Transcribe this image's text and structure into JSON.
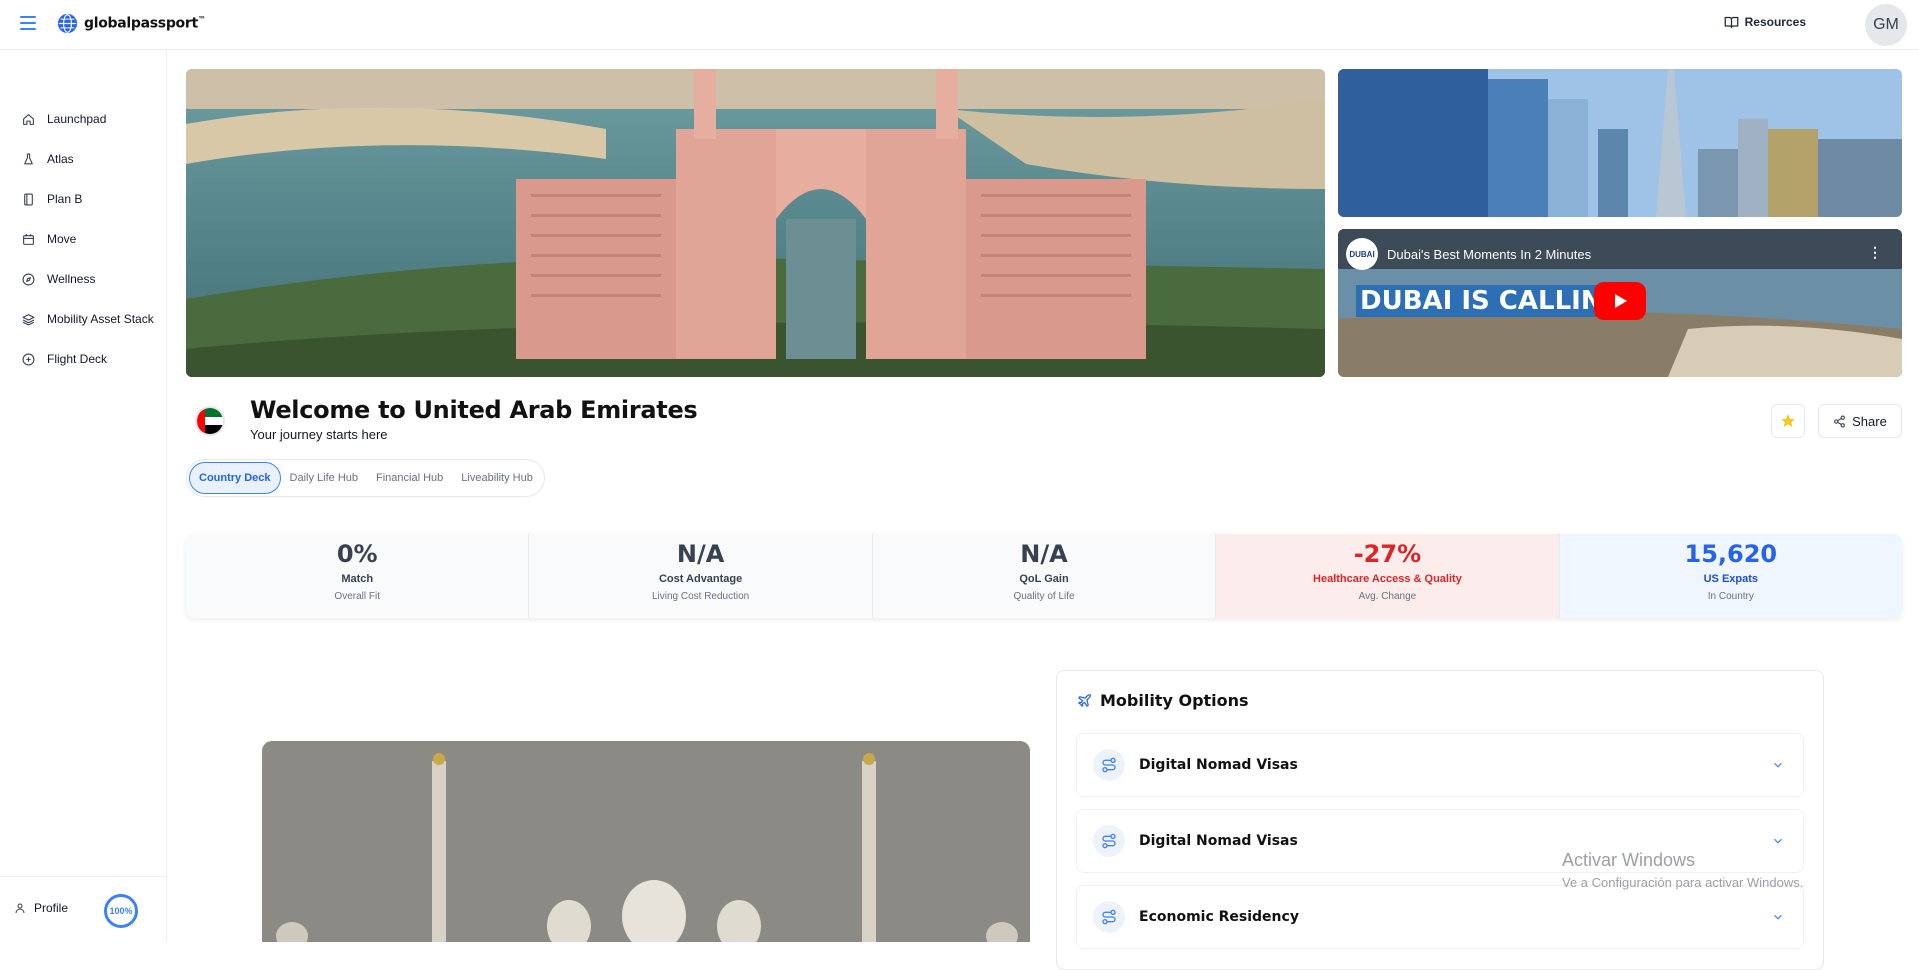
{
  "app": {
    "logo": "globalpassport",
    "logo_tm": "™"
  },
  "header": {
    "resources_label": "Resources",
    "avatar_initials": "GM"
  },
  "sidebar": {
    "items": [
      {
        "label": "Launchpad",
        "icon": "home-icon"
      },
      {
        "label": "Atlas",
        "icon": "flask-icon"
      },
      {
        "label": "Plan B",
        "icon": "book-icon"
      },
      {
        "label": "Move",
        "icon": "calendar-icon"
      },
      {
        "label": "Wellness",
        "icon": "compass-icon"
      },
      {
        "label": "Mobility Asset Stack",
        "icon": "layers-icon"
      },
      {
        "label": "Flight Deck",
        "icon": "plus-circle-icon"
      }
    ],
    "profile_label": "Profile",
    "profile_progress": "100%"
  },
  "video": {
    "title": "Dubai's Best Moments In 2 Minutes",
    "channel_badge": "DUBAI",
    "banner_text": "DUBAI IS CALLIN"
  },
  "country": {
    "title": "Welcome to United Arab Emirates",
    "subtitle": "Your journey starts here",
    "share_label": "Share"
  },
  "tabs": [
    {
      "label": "Country Deck",
      "active": true
    },
    {
      "label": "Daily Life Hub",
      "active": false
    },
    {
      "label": "Financial Hub",
      "active": false
    },
    {
      "label": "Liveability Hub",
      "active": false
    }
  ],
  "stats": [
    {
      "value": "0%",
      "label": "Match",
      "sub": "Overall Fit",
      "tone": "neutral"
    },
    {
      "value": "N/A",
      "label": "Cost Advantage",
      "sub": "Living Cost Reduction",
      "tone": "neutral"
    },
    {
      "value": "N/A",
      "label": "QoL Gain",
      "sub": "Quality of Life",
      "tone": "neutral"
    },
    {
      "value": "-27%",
      "label": "Healthcare Access & Quality",
      "sub": "Avg. Change",
      "tone": "negative"
    },
    {
      "value": "15,620",
      "label": "US Expats",
      "sub": "In Country",
      "tone": "positive"
    }
  ],
  "mobility": {
    "title": "Mobility Options",
    "options": [
      {
        "label": "Digital Nomad Visas"
      },
      {
        "label": "Digital Nomad Visas"
      },
      {
        "label": "Economic Residency"
      }
    ]
  },
  "watermark": {
    "title": "Activar Windows",
    "subtitle": "Ve a Configuración para activar Windows."
  },
  "colors": {
    "accent": "#3b82f6",
    "negative": "#dc2626",
    "positive": "#2563eb"
  }
}
